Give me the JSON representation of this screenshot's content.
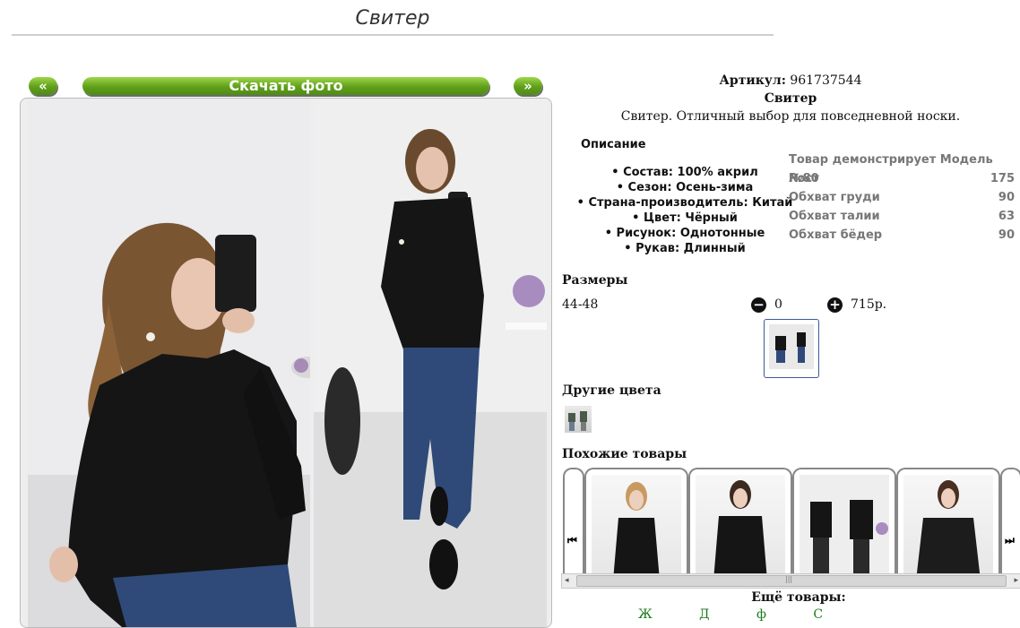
{
  "page_title": "Свитер",
  "nav": {
    "prev_label": "«",
    "next_label": "»",
    "download_label": "Скачать фото"
  },
  "product": {
    "article_label": "Артикул:",
    "article_value": "961737544",
    "name": "Свитер",
    "description": "Свитер. Отличный выбор для повседневной носки."
  },
  "description_section": {
    "heading": "Описание",
    "items": [
      "• Состав: 100% акрил",
      "• Сезон: Осень-зима",
      "• Страна-производитель: Китай",
      "• Цвет: Чёрный",
      "• Рисунок: Однотонные",
      "• Рукав: Длинный"
    ]
  },
  "model": {
    "heading": "Товар демонстрирует Модель №80",
    "rows": [
      {
        "label": "Рост",
        "value": "175"
      },
      {
        "label": "Обхват груди",
        "value": "90"
      },
      {
        "label": "Обхват талии",
        "value": "63"
      },
      {
        "label": "Обхват бёдер",
        "value": "90"
      }
    ]
  },
  "sizes": {
    "heading": "Размеры",
    "size": "44-48",
    "minus_icon": "minus-circle-icon",
    "plus_icon": "plus-circle-icon",
    "quantity": "0",
    "price": "715р."
  },
  "other_colors": {
    "heading": "Другие цвета"
  },
  "similar": {
    "heading": "Похожие товары",
    "left_icon": "skip-back-icon",
    "right_icon": "skip-forward-icon",
    "left_arrow": "⏮",
    "right_arrow": "⏭"
  },
  "scrollbar": {
    "left": "◂",
    "right": "▸",
    "grip": "|||"
  },
  "more": {
    "heading": "Ещё товары:",
    "links": "Ж Д ф С"
  },
  "colors": {
    "accent_green": "#5f9f1a",
    "link_green": "#1a7a1a",
    "sweater_black": "#151515",
    "jeans_blue": "#2f4a78"
  }
}
